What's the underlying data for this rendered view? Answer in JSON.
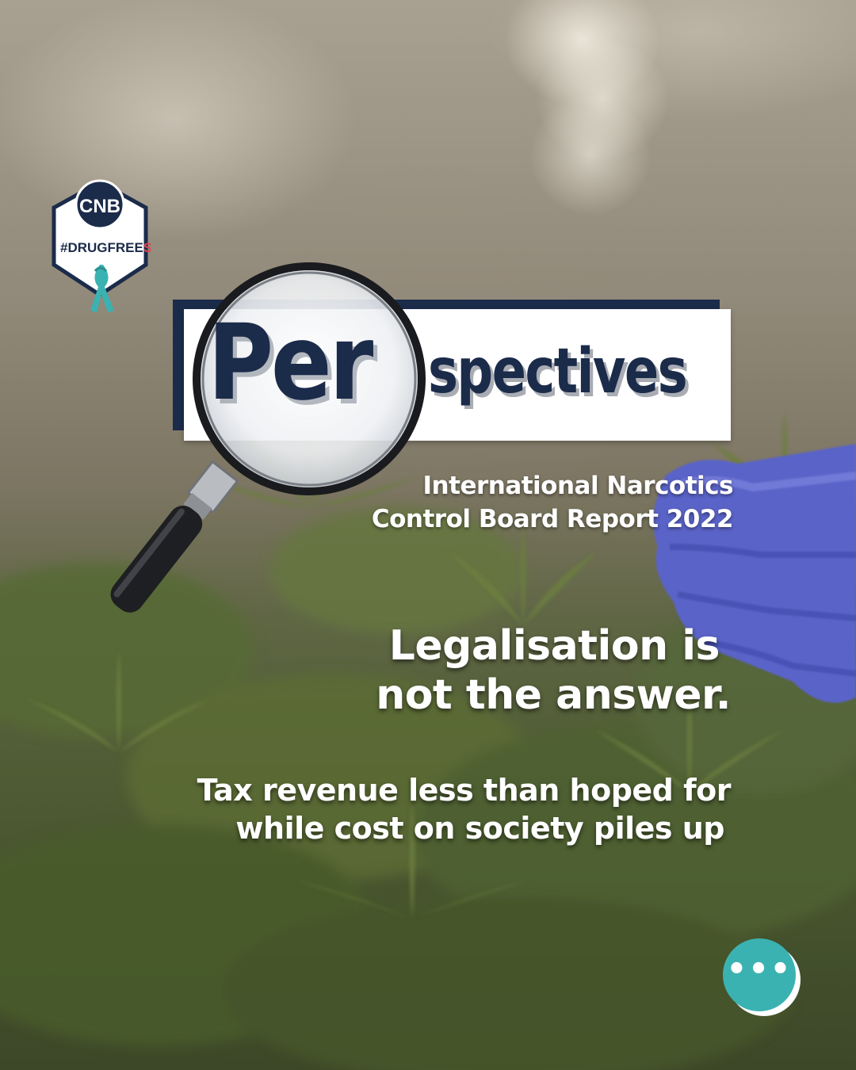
{
  "badge": {
    "org": "CNB",
    "hashtag_main": "#DRUGFREE",
    "hashtag_accent": "SG"
  },
  "banner": {
    "lens_text": "Per",
    "title_rest": "spectives"
  },
  "subtitle": {
    "line1": "International Narcotics",
    "line2": "Control Board Report 2022"
  },
  "headline": {
    "line1": "Legalisation is",
    "line2": "not the answer."
  },
  "body": {
    "line1": "Tax revenue less than hoped for",
    "line2": "while cost on society piles up"
  },
  "more_button": {
    "icon": "more-dots-icon",
    "glyph": "•••"
  },
  "colors": {
    "navy": "#1b2b4a",
    "teal": "#3bb2b2",
    "red": "#e2404d",
    "glove": "#5a63c8"
  }
}
